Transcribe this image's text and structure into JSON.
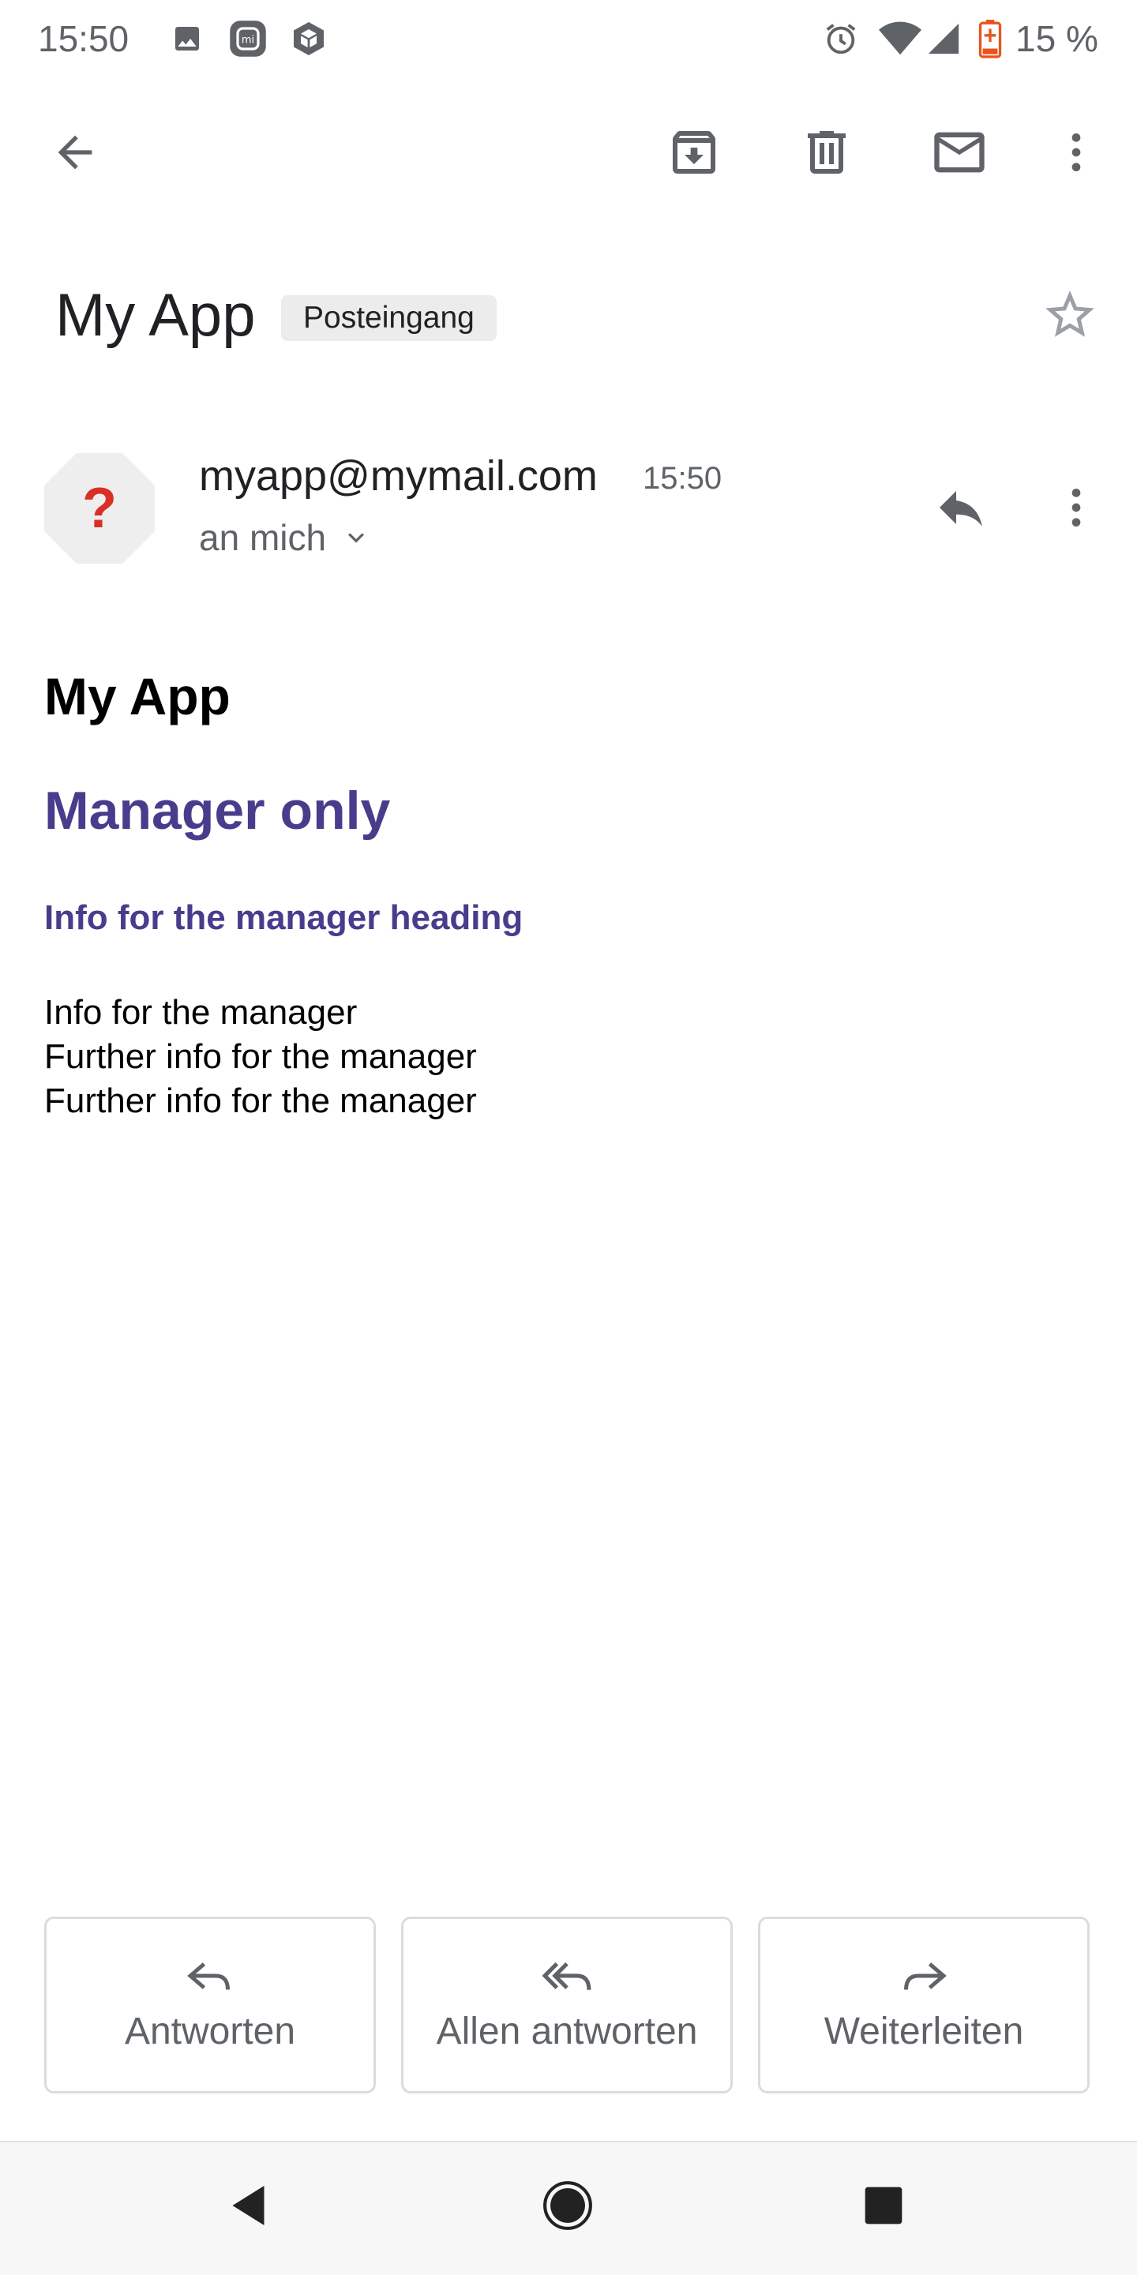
{
  "status_bar": {
    "time": "15:50",
    "left_icons": [
      "image-icon",
      "mi-app-icon",
      "package-icon"
    ],
    "right_icons": [
      "alarm-icon",
      "wifi-icon",
      "signal-icon",
      "battery-low-icon"
    ],
    "battery": "15 %",
    "battery_color": "#e8541c"
  },
  "toolbar": {
    "back": "back-arrow-icon",
    "archive": "archive-icon",
    "delete": "delete-icon",
    "mark_unread": "mail-icon",
    "more": "more-vert-icon"
  },
  "subject": {
    "text": "My App",
    "label": "Posteingang",
    "star": "star-outline-icon"
  },
  "sender": {
    "email": "myapp@mymail.com",
    "time": "15:50",
    "recipient": "an mich",
    "avatar_glyph": "?",
    "avatar_glyph_color": "#d93025"
  },
  "email_body": {
    "title": "My App",
    "heading": "Manager only",
    "subheading": "Info for the manager heading",
    "lines": [
      "Info for the manager",
      "Further info for the manager",
      "Further info for the manager"
    ],
    "accent_color": "#4a3c8c"
  },
  "actions": {
    "reply": "Antworten",
    "reply_all": "Allen antworten",
    "forward": "Weiterleiten"
  }
}
